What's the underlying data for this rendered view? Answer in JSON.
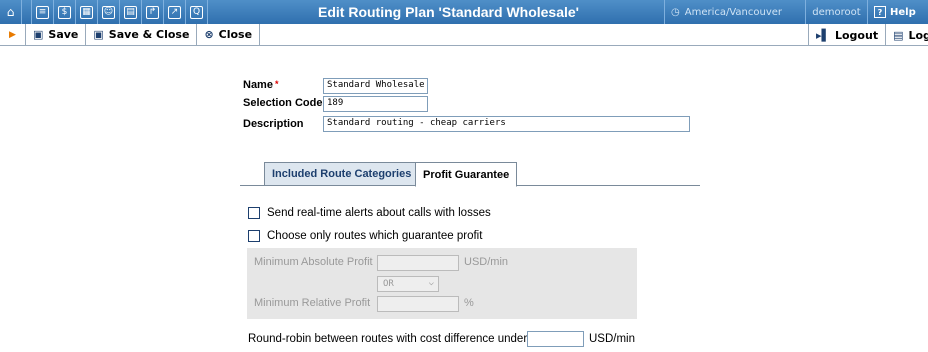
{
  "header": {
    "title": "Edit Routing Plan 'Standard Wholesale'",
    "timezone": "America/Vancouver",
    "user": "demoroot",
    "help": "Help",
    "icons": [
      "home-icon",
      "list-icon",
      "dollar-icon",
      "grid-icon",
      "person-icon",
      "doc-icon",
      "export-icon",
      "chart-icon",
      "search-icon"
    ]
  },
  "toolbar": {
    "save": "Save",
    "save_close": "Save & Close",
    "close": "Close",
    "logout": "Logout",
    "log": "Log"
  },
  "form": {
    "name_label": "Name",
    "name_required": "*",
    "name_value": "Standard Wholesale",
    "selection_code_label": "Selection Code",
    "selection_code_value": "189",
    "description_label": "Description",
    "description_value": "Standard routing - cheap carriers"
  },
  "tabs": [
    {
      "label": "Included Route Categories",
      "active": false
    },
    {
      "label": "Profit Guarantee",
      "active": true
    }
  ],
  "profit": {
    "alert_label": "Send real-time alerts about calls with losses",
    "guarantee_label": "Choose only routes which guarantee profit",
    "min_abs_label": "Minimum Absolute Profit",
    "min_abs_unit": "USD/min",
    "op_value": "OR",
    "min_rel_label": "Minimum Relative Profit",
    "min_rel_unit": "%",
    "roundrobin_label": "Round-robin between routes with cost difference under",
    "roundrobin_unit": "USD/min"
  }
}
